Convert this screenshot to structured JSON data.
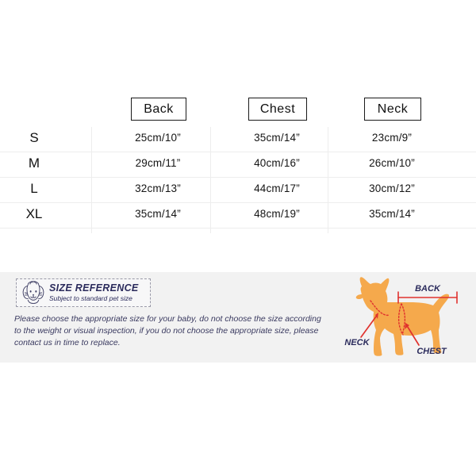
{
  "table": {
    "column_headers": [
      "Back",
      "Chest",
      "Neck"
    ],
    "rows": [
      {
        "size": "S",
        "back": "25cm/10”",
        "chest": "35cm/14”",
        "neck": "23cm/9”"
      },
      {
        "size": "M",
        "back": "29cm/11”",
        "chest": "40cm/16”",
        "neck": "26cm/10”"
      },
      {
        "size": "L",
        "back": "32cm/13”",
        "chest": "44cm/17”",
        "neck": "30cm/12”"
      },
      {
        "size": "XL",
        "back": "35cm/14”",
        "chest": "48cm/19”",
        "neck": "35cm/14”"
      }
    ]
  },
  "info_panel": {
    "badge": {
      "title": "SIZE REFERENCE",
      "subtitle": "Subject to standard pet size",
      "icon": "puppy-face-icon"
    },
    "advice": "Please choose the appropriate size for your baby, do not choose the size according to the weight or visual inspection, if you do not choose the appropriate size, please contact us in time to replace.",
    "diagram": {
      "labels": {
        "back": "BACK",
        "neck": "NECK",
        "chest": "CHEST"
      }
    }
  },
  "colors": {
    "dog_body": "#F5A94C",
    "marker_red": "#E0322E",
    "label_navy": "#2b2b5c",
    "panel_bg": "#f2f2f2",
    "grid_line": "#ededed",
    "header_border": "#1a1a1a"
  }
}
